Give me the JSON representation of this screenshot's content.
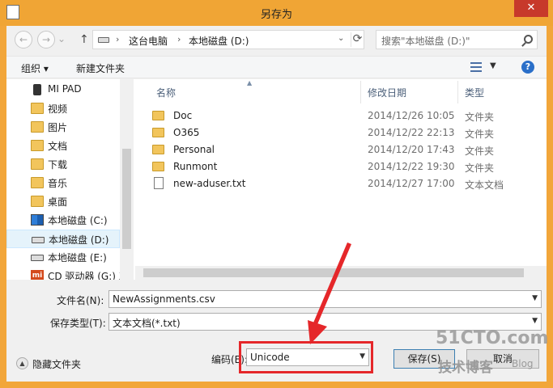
{
  "window": {
    "title": "另存为",
    "close_glyph": "✕"
  },
  "address_bar": {
    "back_glyph": "←",
    "forward_glyph": "→",
    "up_glyph": "↑",
    "separator_glyph": "›",
    "crumbs": [
      "这台电脑",
      "本地磁盘 (D:)"
    ],
    "dropdown_glyph": "⌄",
    "refresh_glyph": "⟳"
  },
  "search": {
    "placeholder": "搜索\"本地磁盘 (D:)\""
  },
  "toolbar": {
    "organize": "组织 ▾",
    "new_folder": "新建文件夹",
    "views_dropdown": "▼",
    "help": "?"
  },
  "nav": {
    "items": [
      {
        "label": "MI PAD",
        "icon": "phone-icon"
      },
      {
        "label": "视频",
        "icon": "video-folder-icon"
      },
      {
        "label": "图片",
        "icon": "pictures-folder-icon"
      },
      {
        "label": "文档",
        "icon": "documents-folder-icon"
      },
      {
        "label": "下载",
        "icon": "downloads-folder-icon"
      },
      {
        "label": "音乐",
        "icon": "music-folder-icon"
      },
      {
        "label": "桌面",
        "icon": "desktop-folder-icon"
      },
      {
        "label": "本地磁盘 (C:)",
        "icon": "system-drive-icon"
      },
      {
        "label": "本地磁盘 (D:)",
        "icon": "drive-icon",
        "selected": true
      },
      {
        "label": "本地磁盘 (E:)",
        "icon": "drive-icon"
      },
      {
        "label": "CD 驱动器 (G:) X",
        "icon": "mi-cd-drive-icon"
      }
    ],
    "mi_text": "mi"
  },
  "file_list": {
    "columns": {
      "name": "名称",
      "date": "修改日期",
      "type": "类型"
    },
    "rows": [
      {
        "name": "Doc",
        "date": "2014/12/26 10:05",
        "type": "文件夹",
        "kind": "folder"
      },
      {
        "name": "O365",
        "date": "2014/12/22 22:13",
        "type": "文件夹",
        "kind": "folder"
      },
      {
        "name": "Personal",
        "date": "2014/12/20 17:43",
        "type": "文件夹",
        "kind": "folder"
      },
      {
        "name": "Runmont",
        "date": "2014/12/22 19:30",
        "type": "文件夹",
        "kind": "folder"
      },
      {
        "name": "new-aduser.txt",
        "date": "2014/12/27 17:00",
        "type": "文本文档",
        "kind": "text"
      }
    ]
  },
  "form": {
    "filename_label": "文件名(N):",
    "filename_value": "NewAssignments.csv",
    "filetype_label": "保存类型(T):",
    "filetype_value": "文本文档(*.txt)",
    "encoding_label": "编码(E):",
    "encoding_value": "Unicode",
    "hide_folders": "隐藏文件夹",
    "save_button": "保存(S)",
    "cancel_button": "取消"
  },
  "watermark": {
    "line1": "51CTO.com",
    "line2": "技术博客",
    "line3": "Blog"
  },
  "colors": {
    "title_bar": "#f0a535",
    "highlight_box": "#e5272a",
    "selected_nav": "#e5f3fb"
  }
}
